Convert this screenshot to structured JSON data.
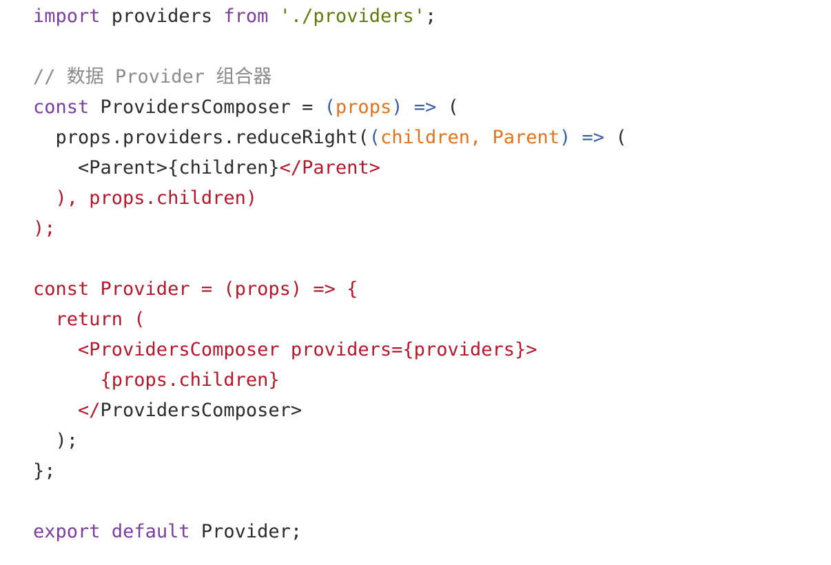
{
  "colors": {
    "keyword": "#7a3e9d",
    "string": "#5c7a0a",
    "comment": "#8a8a8a",
    "parameter": "#e0731e",
    "punctuation": "#3a5fa0",
    "jsx": "#b2182b",
    "text": "#2b2b2b",
    "background": "#ffffff"
  },
  "lines": [
    [
      {
        "t": "kw",
        "v": "import"
      },
      {
        "t": "plain",
        "v": " providers "
      },
      {
        "t": "kw",
        "v": "from"
      },
      {
        "t": "plain",
        "v": " "
      },
      {
        "t": "str",
        "v": "'./providers'"
      },
      {
        "t": "plain",
        "v": ";"
      }
    ],
    [],
    [
      {
        "t": "comment",
        "v": "// 数据 Provider 组合器"
      }
    ],
    [
      {
        "t": "kw",
        "v": "const"
      },
      {
        "t": "plain",
        "v": " ProvidersComposer = "
      },
      {
        "t": "punct",
        "v": "("
      },
      {
        "t": "param",
        "v": "props"
      },
      {
        "t": "punct",
        "v": ") =>"
      },
      {
        "t": "plain",
        "v": " ("
      }
    ],
    [
      {
        "t": "plain",
        "v": "  props.providers.reduceRight("
      },
      {
        "t": "punct",
        "v": "("
      },
      {
        "t": "param",
        "v": "children, Parent"
      },
      {
        "t": "punct",
        "v": ") =>"
      },
      {
        "t": "plain",
        "v": " ("
      }
    ],
    [
      {
        "t": "plain",
        "v": "    <Parent>{children}"
      },
      {
        "t": "red",
        "v": "</Parent>"
      }
    ],
    [
      {
        "t": "red",
        "v": "  ), props.children)"
      }
    ],
    [
      {
        "t": "red",
        "v": ");"
      }
    ],
    [],
    [
      {
        "t": "red",
        "v": "const Provider = (props) => {"
      }
    ],
    [
      {
        "t": "red",
        "v": "  return ("
      }
    ],
    [
      {
        "t": "red",
        "v": "    <ProvidersComposer providers={providers}>"
      }
    ],
    [
      {
        "t": "red",
        "v": "      {props.children}"
      }
    ],
    [
      {
        "t": "red",
        "v": "    </"
      },
      {
        "t": "plain",
        "v": "ProvidersComposer>"
      }
    ],
    [
      {
        "t": "plain",
        "v": "  );"
      }
    ],
    [
      {
        "t": "plain",
        "v": "};"
      }
    ],
    [],
    [
      {
        "t": "kw",
        "v": "export"
      },
      {
        "t": "plain",
        "v": " "
      },
      {
        "t": "kw",
        "v": "default"
      },
      {
        "t": "plain",
        "v": " Provider;"
      }
    ]
  ]
}
